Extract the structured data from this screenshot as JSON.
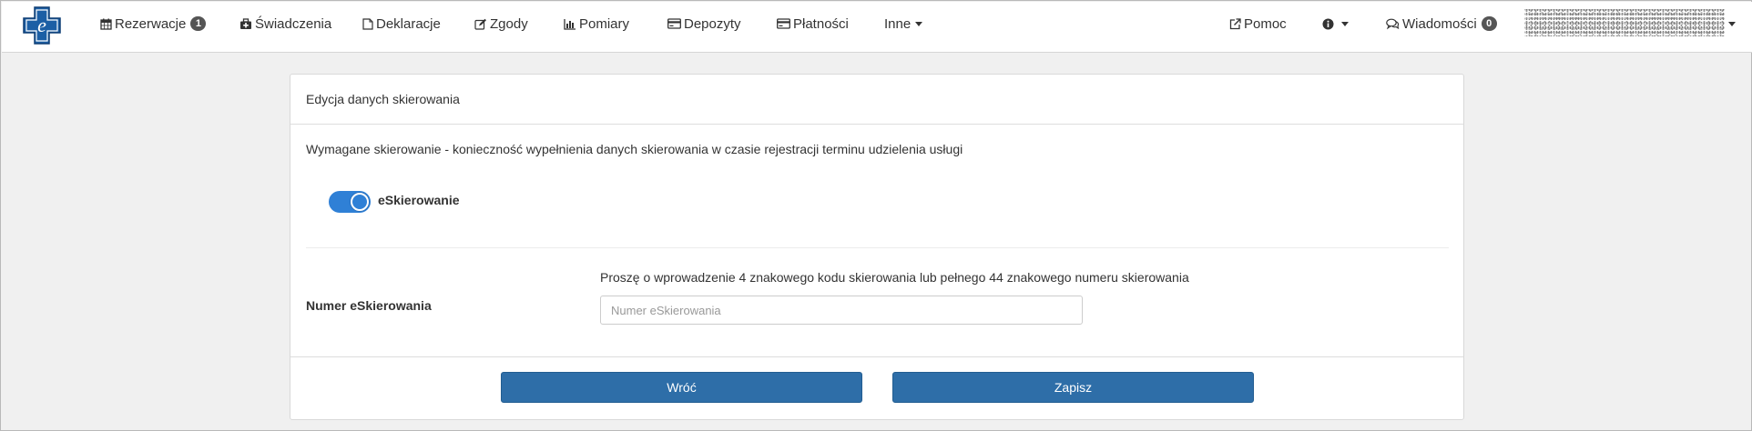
{
  "colors": {
    "brand": "#1c5fa5",
    "primary_button": "#2e6ea8",
    "toggle_on": "#2f80d6",
    "badge": "#555555"
  },
  "nav": {
    "left": [
      {
        "id": "rezerwacje",
        "label": "Rezerwacje",
        "icon": "calendar-icon",
        "badge": "1"
      },
      {
        "id": "swiadczenia",
        "label": "Świadczenia",
        "icon": "medkit-icon"
      },
      {
        "id": "deklaracje",
        "label": "Deklaracje",
        "icon": "document-icon"
      },
      {
        "id": "zgody",
        "label": "Zgody",
        "icon": "edit-icon"
      },
      {
        "id": "pomiary",
        "label": "Pomiary",
        "icon": "bar-chart-icon"
      },
      {
        "id": "depozyty",
        "label": "Depozyty",
        "icon": "credit-card-icon"
      },
      {
        "id": "platnosci",
        "label": "Płatności",
        "icon": "credit-card-icon"
      },
      {
        "id": "inne",
        "label": "Inne",
        "dropdown": true
      }
    ],
    "right": [
      {
        "id": "pomoc",
        "label": "Pomoc",
        "icon": "external-link-icon"
      },
      {
        "id": "info",
        "label": "",
        "icon": "info-icon",
        "dropdown": true
      },
      {
        "id": "wiadomosci",
        "label": "Wiadomości",
        "icon": "comments-icon",
        "badge": "0"
      }
    ]
  },
  "panel": {
    "heading": "Edycja danych skierowania",
    "info": "Wymagane skierowanie - konieczność wypełnienia danych skierowania w czasie rejestracji terminu udzielenia usługi",
    "toggle": {
      "label": "eSkierowanie",
      "checked": true
    },
    "field": {
      "label": "Numer eSkierowania",
      "help": "Proszę o wprowadzenie 4 znakowego kodu skierowania lub pełnego 44 znakowego numeru skierowania",
      "placeholder": "Numer eSkierowania",
      "value": ""
    },
    "buttons": {
      "back": "Wróć",
      "save": "Zapisz"
    }
  }
}
